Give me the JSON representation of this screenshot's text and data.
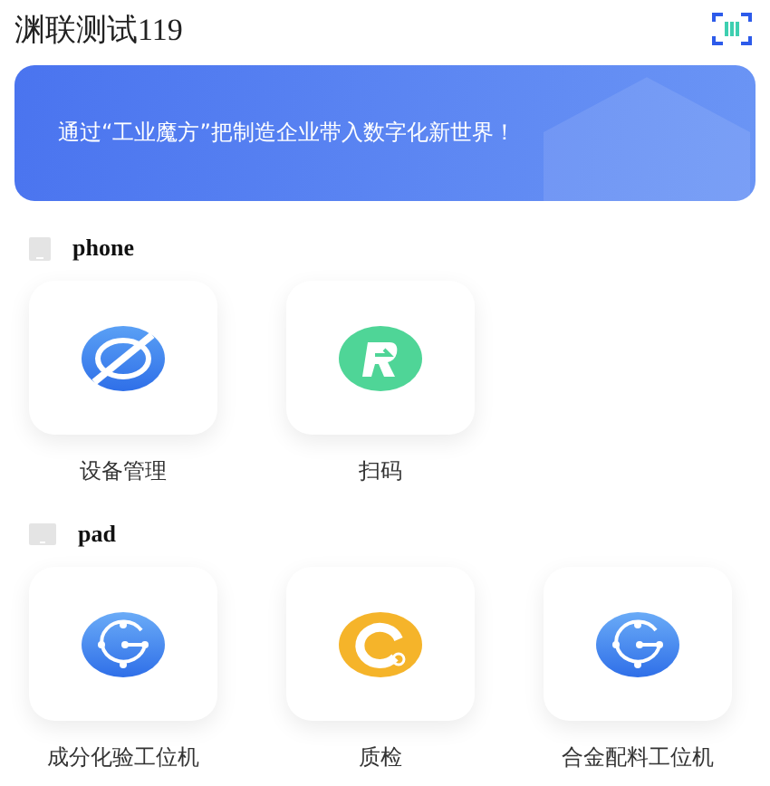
{
  "header": {
    "title": "渊联测试119"
  },
  "banner": {
    "text": "通过“工业魔方”把制造企业带入数字化新世界！"
  },
  "sections": [
    {
      "title": "phone",
      "kind": "phone",
      "apps": [
        {
          "label": "设备管理",
          "kind": "equipment"
        },
        {
          "label": "扫码",
          "kind": "scan"
        }
      ]
    },
    {
      "title": "pad",
      "kind": "pad",
      "apps": [
        {
          "label": "成分化验工位机",
          "kind": "workstation"
        },
        {
          "label": "质检",
          "kind": "quality"
        },
        {
          "label": "合金配料工位机",
          "kind": "workstation"
        }
      ]
    }
  ]
}
